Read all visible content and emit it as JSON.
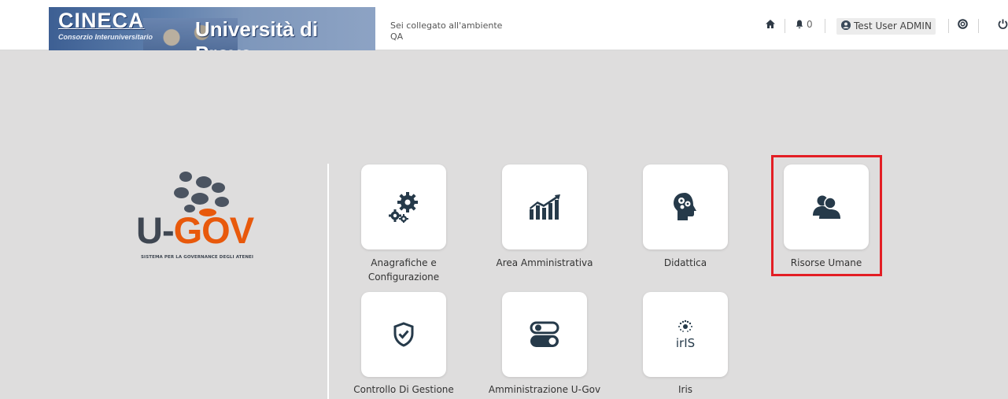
{
  "header": {
    "logo": {
      "cineca": "CINECA",
      "consorzio": "Consorzio Interuniversitario",
      "university": "Università di Prova"
    },
    "environment_line1": "Sei collegato all'ambiente",
    "environment_line2": "QA",
    "notifications_count": "0",
    "user_name": "Test User ADMIN"
  },
  "brand": {
    "name_u": "U-",
    "name_gov": "GOV",
    "tagline": "SISTEMA PER LA GOVERNANCE DEGLI ATENEI"
  },
  "modules": [
    {
      "label": "Anagrafiche e Configurazione",
      "icon": "gears-icon"
    },
    {
      "label": "Area Amministrativa",
      "icon": "chart-growth-icon"
    },
    {
      "label": "Didattica",
      "icon": "head-gears-icon"
    },
    {
      "label": "Risorse Umane",
      "icon": "users-icon"
    },
    {
      "label": "Controllo Di Gestione",
      "icon": "shield-check-icon"
    },
    {
      "label": "Amministrazione U-Gov",
      "icon": "toggles-icon"
    },
    {
      "label": "Iris",
      "icon": "iris-icon"
    }
  ],
  "colors": {
    "icon": "#263a4a",
    "highlight": "#e31e24",
    "brand_orange": "#e8590c"
  }
}
